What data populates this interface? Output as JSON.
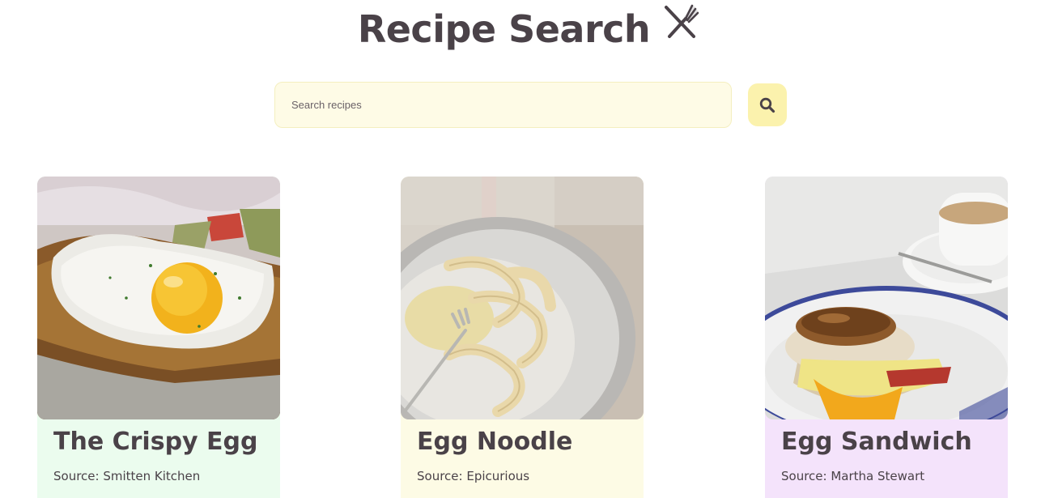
{
  "header": {
    "title": "Recipe Search",
    "icon": "utensils-icon"
  },
  "search": {
    "placeholder": "Search recipes",
    "value": "",
    "button_icon": "search-icon"
  },
  "colors": {
    "text": "#4a4248",
    "search_field_bg": "#fefbe6",
    "search_button_bg": "#fbf2ad"
  },
  "recipes": [
    {
      "title": "The Crispy Egg",
      "source": "Source: Smitten Kitchen",
      "card_color": "#ebfcee",
      "image": "fried-egg-on-toast-photo"
    },
    {
      "title": "Egg Noodle",
      "source": "Source: Epicurious",
      "card_color": "#fdfbe5",
      "image": "egg-noodles-plate-photo"
    },
    {
      "title": "Egg Sandwich",
      "source": "Source: Martha Stewart",
      "card_color": "#f4e3fb",
      "image": "egg-sandwich-plate-photo"
    }
  ]
}
